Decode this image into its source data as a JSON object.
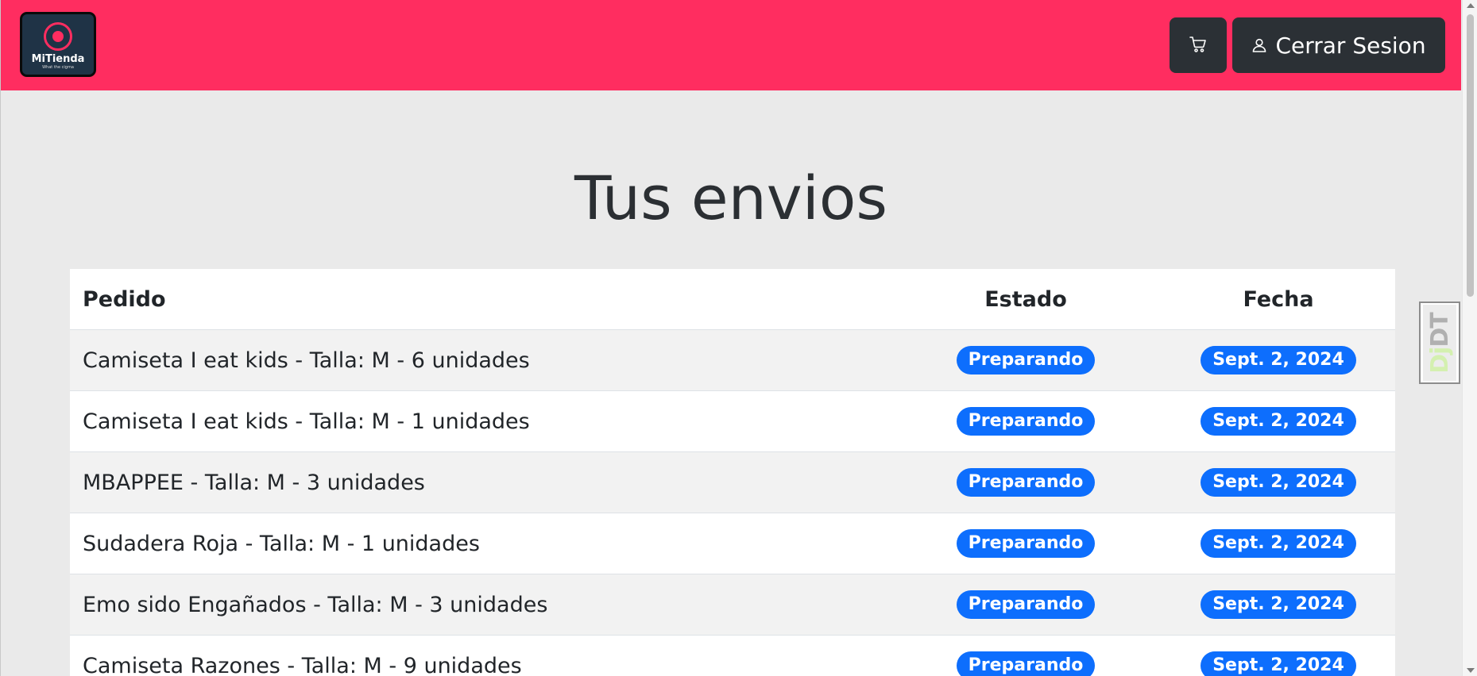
{
  "header": {
    "logo": {
      "name": "MiTienda",
      "tagline": "What the cigma"
    },
    "cart_icon": "shopping-cart-icon",
    "logout": {
      "icon": "user-icon",
      "label": "Cerrar Sesion"
    }
  },
  "main": {
    "title": "Tus envios",
    "table": {
      "headers": {
        "order": "Pedido",
        "status": "Estado",
        "date": "Fecha"
      },
      "rows": [
        {
          "order": "Camiseta I eat kids - Talla: M - 6 unidades",
          "status": "Preparando",
          "date": "Sept. 2, 2024"
        },
        {
          "order": "Camiseta I eat kids - Talla: M - 1 unidades",
          "status": "Preparando",
          "date": "Sept. 2, 2024"
        },
        {
          "order": "MBAPPEE - Talla: M - 3 unidades",
          "status": "Preparando",
          "date": "Sept. 2, 2024"
        },
        {
          "order": "Sudadera Roja - Talla: M - 1 unidades",
          "status": "Preparando",
          "date": "Sept. 2, 2024"
        },
        {
          "order": "Emo sido Engañados - Talla: M - 3 unidades",
          "status": "Preparando",
          "date": "Sept. 2, 2024"
        },
        {
          "order": "Camiseta Razones - Talla: M - 9 unidades",
          "status": "Preparando",
          "date": "Sept. 2, 2024"
        }
      ]
    }
  },
  "debug_toolbar": {
    "label_dj": "Dj",
    "label_dt": "DT"
  },
  "colors": {
    "navbar": "#ff2d60",
    "button_dark": "#2b3035",
    "badge": "#0d6efd",
    "background": "#eaeaea"
  }
}
